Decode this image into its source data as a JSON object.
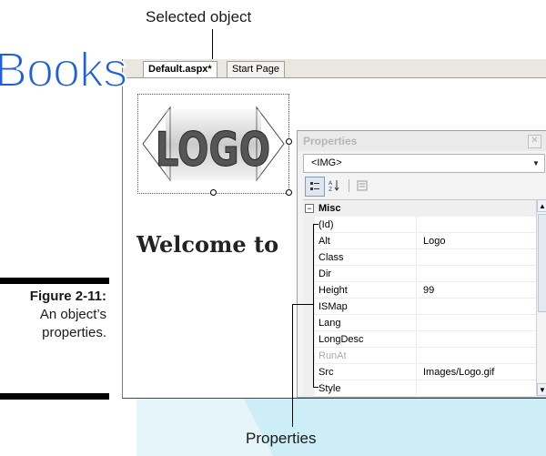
{
  "callouts": {
    "selected_object": "Selected object",
    "properties": "Properties"
  },
  "figure": {
    "number": "Figure 2-11:",
    "caption_line1": "An object’s",
    "caption_line2": "properties."
  },
  "watermark": "Books",
  "editor": {
    "tabs": [
      {
        "label": "Default.aspx*",
        "active": true
      },
      {
        "label": "Start Page",
        "active": false
      }
    ],
    "logo_image_text": "LOGO",
    "page_text": "Welcome to"
  },
  "properties_panel": {
    "title": "Properties",
    "close_glyph": "✕",
    "selected_object": "<IMG>",
    "toolbar": [
      "categorized-icon",
      "alphabetical-icon",
      "property-pages-icon"
    ],
    "category": "Misc",
    "rows": [
      {
        "name": "(Id)",
        "value": ""
      },
      {
        "name": "Alt",
        "value": "Logo"
      },
      {
        "name": "Class",
        "value": ""
      },
      {
        "name": "Dir",
        "value": ""
      },
      {
        "name": "Height",
        "value": "99"
      },
      {
        "name": "ISMap",
        "value": ""
      },
      {
        "name": "Lang",
        "value": ""
      },
      {
        "name": "LongDesc",
        "value": ""
      },
      {
        "name": "RunAt",
        "value": "",
        "disabled": true
      },
      {
        "name": "Src",
        "value": "Images/Logo.gif"
      },
      {
        "name": "Style",
        "value": ""
      }
    ]
  },
  "colors": {
    "swoosh": "#c8ecf4",
    "watermark": "#1e5fe0"
  }
}
